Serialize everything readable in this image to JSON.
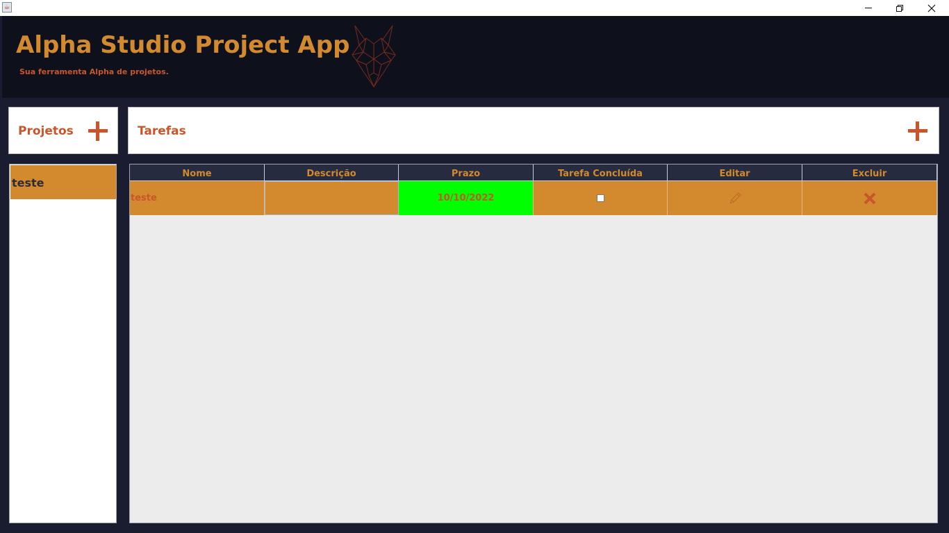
{
  "window": {
    "icon": "java-icon"
  },
  "header": {
    "title": "Alpha Studio Project App",
    "subtitle": "Sua ferramenta Alpha de projetos.",
    "logo": "wolf-logo-icon"
  },
  "projects": {
    "title": "Projetos",
    "add_icon": "plus-icon",
    "items": [
      {
        "label": "teste",
        "selected": true
      }
    ]
  },
  "tasks": {
    "title": "Tarefas",
    "add_icon": "plus-icon",
    "columns": [
      "Nome",
      "Descrição",
      "Prazo",
      "Tarefa Concluída",
      "Editar",
      "Excluir"
    ],
    "rows": [
      {
        "name": "teste",
        "description": "",
        "deadline": "10/10/2022",
        "done": false,
        "edit_icon": "pencil-icon",
        "delete_icon": "x-icon"
      }
    ]
  },
  "colors": {
    "accent": "#d38a2f",
    "accent_dark": "#c9552b",
    "header_bg": "#0e111c",
    "body_bg": "#1a1d30",
    "deadline_bg": "#00ff00"
  }
}
